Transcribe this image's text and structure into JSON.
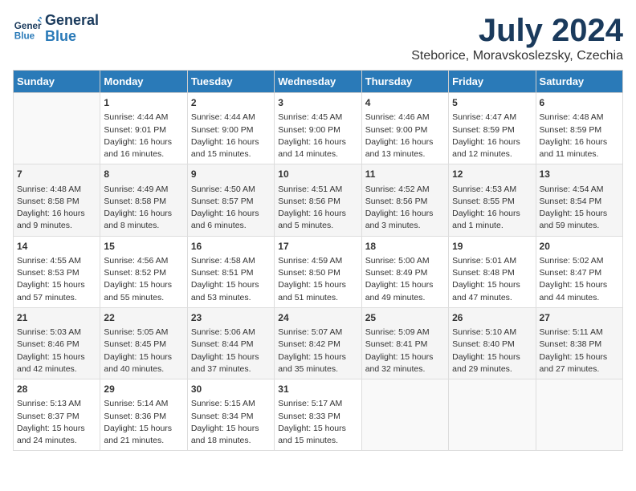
{
  "header": {
    "logo_general": "General",
    "logo_blue": "Blue",
    "month": "July 2024",
    "location": "Steborice, Moravskoslezsky, Czechia"
  },
  "days_of_week": [
    "Sunday",
    "Monday",
    "Tuesday",
    "Wednesday",
    "Thursday",
    "Friday",
    "Saturday"
  ],
  "weeks": [
    [
      {
        "day": "",
        "sunrise": "",
        "sunset": "",
        "daylight": ""
      },
      {
        "day": "1",
        "sunrise": "Sunrise: 4:44 AM",
        "sunset": "Sunset: 9:01 PM",
        "daylight": "Daylight: 16 hours and 16 minutes."
      },
      {
        "day": "2",
        "sunrise": "Sunrise: 4:44 AM",
        "sunset": "Sunset: 9:00 PM",
        "daylight": "Daylight: 16 hours and 15 minutes."
      },
      {
        "day": "3",
        "sunrise": "Sunrise: 4:45 AM",
        "sunset": "Sunset: 9:00 PM",
        "daylight": "Daylight: 16 hours and 14 minutes."
      },
      {
        "day": "4",
        "sunrise": "Sunrise: 4:46 AM",
        "sunset": "Sunset: 9:00 PM",
        "daylight": "Daylight: 16 hours and 13 minutes."
      },
      {
        "day": "5",
        "sunrise": "Sunrise: 4:47 AM",
        "sunset": "Sunset: 8:59 PM",
        "daylight": "Daylight: 16 hours and 12 minutes."
      },
      {
        "day": "6",
        "sunrise": "Sunrise: 4:48 AM",
        "sunset": "Sunset: 8:59 PM",
        "daylight": "Daylight: 16 hours and 11 minutes."
      }
    ],
    [
      {
        "day": "7",
        "sunrise": "Sunrise: 4:48 AM",
        "sunset": "Sunset: 8:58 PM",
        "daylight": "Daylight: 16 hours and 9 minutes."
      },
      {
        "day": "8",
        "sunrise": "Sunrise: 4:49 AM",
        "sunset": "Sunset: 8:58 PM",
        "daylight": "Daylight: 16 hours and 8 minutes."
      },
      {
        "day": "9",
        "sunrise": "Sunrise: 4:50 AM",
        "sunset": "Sunset: 8:57 PM",
        "daylight": "Daylight: 16 hours and 6 minutes."
      },
      {
        "day": "10",
        "sunrise": "Sunrise: 4:51 AM",
        "sunset": "Sunset: 8:56 PM",
        "daylight": "Daylight: 16 hours and 5 minutes."
      },
      {
        "day": "11",
        "sunrise": "Sunrise: 4:52 AM",
        "sunset": "Sunset: 8:56 PM",
        "daylight": "Daylight: 16 hours and 3 minutes."
      },
      {
        "day": "12",
        "sunrise": "Sunrise: 4:53 AM",
        "sunset": "Sunset: 8:55 PM",
        "daylight": "Daylight: 16 hours and 1 minute."
      },
      {
        "day": "13",
        "sunrise": "Sunrise: 4:54 AM",
        "sunset": "Sunset: 8:54 PM",
        "daylight": "Daylight: 15 hours and 59 minutes."
      }
    ],
    [
      {
        "day": "14",
        "sunrise": "Sunrise: 4:55 AM",
        "sunset": "Sunset: 8:53 PM",
        "daylight": "Daylight: 15 hours and 57 minutes."
      },
      {
        "day": "15",
        "sunrise": "Sunrise: 4:56 AM",
        "sunset": "Sunset: 8:52 PM",
        "daylight": "Daylight: 15 hours and 55 minutes."
      },
      {
        "day": "16",
        "sunrise": "Sunrise: 4:58 AM",
        "sunset": "Sunset: 8:51 PM",
        "daylight": "Daylight: 15 hours and 53 minutes."
      },
      {
        "day": "17",
        "sunrise": "Sunrise: 4:59 AM",
        "sunset": "Sunset: 8:50 PM",
        "daylight": "Daylight: 15 hours and 51 minutes."
      },
      {
        "day": "18",
        "sunrise": "Sunrise: 5:00 AM",
        "sunset": "Sunset: 8:49 PM",
        "daylight": "Daylight: 15 hours and 49 minutes."
      },
      {
        "day": "19",
        "sunrise": "Sunrise: 5:01 AM",
        "sunset": "Sunset: 8:48 PM",
        "daylight": "Daylight: 15 hours and 47 minutes."
      },
      {
        "day": "20",
        "sunrise": "Sunrise: 5:02 AM",
        "sunset": "Sunset: 8:47 PM",
        "daylight": "Daylight: 15 hours and 44 minutes."
      }
    ],
    [
      {
        "day": "21",
        "sunrise": "Sunrise: 5:03 AM",
        "sunset": "Sunset: 8:46 PM",
        "daylight": "Daylight: 15 hours and 42 minutes."
      },
      {
        "day": "22",
        "sunrise": "Sunrise: 5:05 AM",
        "sunset": "Sunset: 8:45 PM",
        "daylight": "Daylight: 15 hours and 40 minutes."
      },
      {
        "day": "23",
        "sunrise": "Sunrise: 5:06 AM",
        "sunset": "Sunset: 8:44 PM",
        "daylight": "Daylight: 15 hours and 37 minutes."
      },
      {
        "day": "24",
        "sunrise": "Sunrise: 5:07 AM",
        "sunset": "Sunset: 8:42 PM",
        "daylight": "Daylight: 15 hours and 35 minutes."
      },
      {
        "day": "25",
        "sunrise": "Sunrise: 5:09 AM",
        "sunset": "Sunset: 8:41 PM",
        "daylight": "Daylight: 15 hours and 32 minutes."
      },
      {
        "day": "26",
        "sunrise": "Sunrise: 5:10 AM",
        "sunset": "Sunset: 8:40 PM",
        "daylight": "Daylight: 15 hours and 29 minutes."
      },
      {
        "day": "27",
        "sunrise": "Sunrise: 5:11 AM",
        "sunset": "Sunset: 8:38 PM",
        "daylight": "Daylight: 15 hours and 27 minutes."
      }
    ],
    [
      {
        "day": "28",
        "sunrise": "Sunrise: 5:13 AM",
        "sunset": "Sunset: 8:37 PM",
        "daylight": "Daylight: 15 hours and 24 minutes."
      },
      {
        "day": "29",
        "sunrise": "Sunrise: 5:14 AM",
        "sunset": "Sunset: 8:36 PM",
        "daylight": "Daylight: 15 hours and 21 minutes."
      },
      {
        "day": "30",
        "sunrise": "Sunrise: 5:15 AM",
        "sunset": "Sunset: 8:34 PM",
        "daylight": "Daylight: 15 hours and 18 minutes."
      },
      {
        "day": "31",
        "sunrise": "Sunrise: 5:17 AM",
        "sunset": "Sunset: 8:33 PM",
        "daylight": "Daylight: 15 hours and 15 minutes."
      },
      {
        "day": "",
        "sunrise": "",
        "sunset": "",
        "daylight": ""
      },
      {
        "day": "",
        "sunrise": "",
        "sunset": "",
        "daylight": ""
      },
      {
        "day": "",
        "sunrise": "",
        "sunset": "",
        "daylight": ""
      }
    ]
  ]
}
